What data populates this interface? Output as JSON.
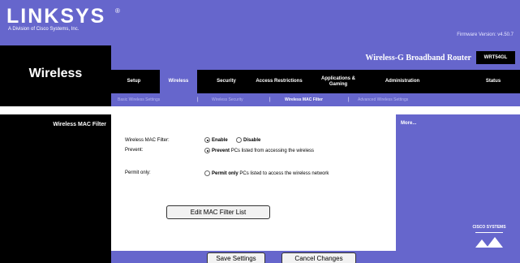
{
  "brand": {
    "logo": "LINKSYS",
    "registered": "®",
    "tagline": "A Division of Cisco Systems, Inc.",
    "firmware": "Firmware Version: v4.50.7"
  },
  "header": {
    "page_title": "Wireless",
    "product_name": "Wireless-G Broadband Router",
    "model": "WRT54GL"
  },
  "tabs": [
    {
      "label": "Setup",
      "active": false
    },
    {
      "label": "Wireless",
      "active": true
    },
    {
      "label": "Security",
      "active": false
    },
    {
      "label": "Access Restrictions",
      "active": false
    },
    {
      "label": "Applications & Gaming",
      "active": false
    },
    {
      "label": "Administration",
      "active": false
    },
    {
      "label": "Status",
      "active": false
    }
  ],
  "subtabs": [
    {
      "label": "Basic Wireless Settings",
      "active": false
    },
    {
      "label": "Wireless Security",
      "active": false
    },
    {
      "label": "Wireless MAC Filter",
      "active": true
    },
    {
      "label": "Advanced Wireless Settings",
      "active": false
    }
  ],
  "section": {
    "title": "Wireless MAC Filter"
  },
  "form": {
    "mac_filter_label": "Wireless MAC Filter:",
    "enable_label": "Enable",
    "disable_label": "Disable",
    "mac_filter_value": "Enable",
    "prevent_label": "Prevent:",
    "prevent_option_bold": "Prevent",
    "prevent_option_text": "PCs listed from accessing the wireless",
    "prevent_selected": true,
    "permit_label": "Permit only:",
    "permit_option_bold": "Permit only",
    "permit_option_text": "PCs listed to access the wireless network",
    "permit_selected": false,
    "edit_button": "Edit MAC Filter List"
  },
  "help": {
    "more_link": "More..."
  },
  "footer": {
    "save_button": "Save Settings",
    "cancel_button": "Cancel Changes",
    "cisco_logo": "CISCO SYSTEMS"
  },
  "colors": {
    "brand_purple": "#6666cc",
    "black": "#000000",
    "white": "#ffffff"
  }
}
